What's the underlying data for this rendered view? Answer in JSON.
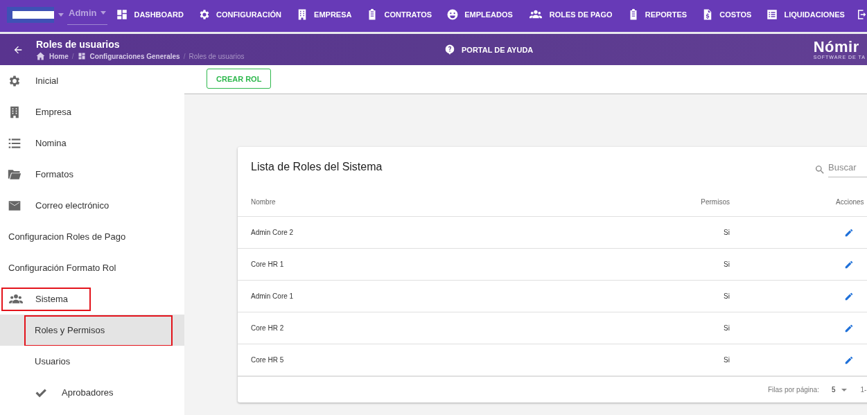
{
  "top_nav": {
    "company_select": {
      "value_redacted": true
    },
    "role_select": {
      "value": "Admin"
    },
    "items": [
      {
        "label": "DASHBOARD"
      },
      {
        "label": "CONFIGURACIÓN"
      },
      {
        "label": "EMPRESA"
      },
      {
        "label": "CONTRATOS"
      },
      {
        "label": "EMPLEADOS"
      },
      {
        "label": "ROLES DE PAGO"
      },
      {
        "label": "REPORTES"
      },
      {
        "label": "COSTOS"
      },
      {
        "label": "LIQUIDACIONES"
      }
    ]
  },
  "header": {
    "title": "Roles de usuarios",
    "breadcrumb_separator": "/",
    "breadcrumb": [
      {
        "label": "Home",
        "current": false
      },
      {
        "label": "Configuraciones Generales",
        "current": false
      },
      {
        "label": "Roles de usuarios",
        "current": true
      }
    ],
    "help_link": "PORTAL DE AYUDA",
    "logo": {
      "name": "Nómir",
      "tagline": "SOFTWARE DE TA"
    }
  },
  "sidebar": {
    "items": [
      {
        "label": "Inicial",
        "kind": "icon",
        "annotated": false,
        "selected": false
      },
      {
        "label": "Empresa",
        "kind": "icon",
        "annotated": false,
        "selected": false
      },
      {
        "label": "Nomina",
        "kind": "icon",
        "annotated": false,
        "selected": false
      },
      {
        "label": "Formatos",
        "kind": "icon",
        "annotated": false,
        "selected": false
      },
      {
        "label": "Correo electrónico",
        "kind": "icon",
        "annotated": false,
        "selected": false
      },
      {
        "label": "Configuracion Roles de Pago",
        "kind": "plain",
        "annotated": false,
        "selected": false
      },
      {
        "label": "Configuración Formato Rol",
        "kind": "plain",
        "annotated": false,
        "selected": false
      },
      {
        "label": "Sistema",
        "kind": "icon",
        "annotated": true,
        "selected": false,
        "expanded": true,
        "children": [
          {
            "label": "Roles y Permisos",
            "kind": "plain",
            "annotated": true,
            "selected": true
          },
          {
            "label": "Usuarios",
            "kind": "plain",
            "annotated": false,
            "selected": false
          },
          {
            "label": "Aprobadores",
            "kind": "icon",
            "annotated": false,
            "selected": false
          }
        ]
      }
    ]
  },
  "toolbar": {
    "create_button": "CREAR ROL"
  },
  "roles_card": {
    "title": "Lista de Roles del Sistema",
    "search": {
      "placeholder": "Buscar"
    },
    "table": {
      "columns": [
        "Nombre",
        "Permisos",
        "Acciones"
      ],
      "rows": [
        {
          "name": "Admin Core 2",
          "permisos": "Si"
        },
        {
          "name": "Core HR 1",
          "permisos": "Si"
        },
        {
          "name": "Admin Core 1",
          "permisos": "Si"
        },
        {
          "name": "Core HR 2",
          "permisos": "Si"
        },
        {
          "name": "Core HR 5",
          "permisos": "Si"
        }
      ]
    },
    "pagination": {
      "rows_per_page_label": "Filas por página:",
      "rows_per_page": "5",
      "range": "1-"
    }
  }
}
